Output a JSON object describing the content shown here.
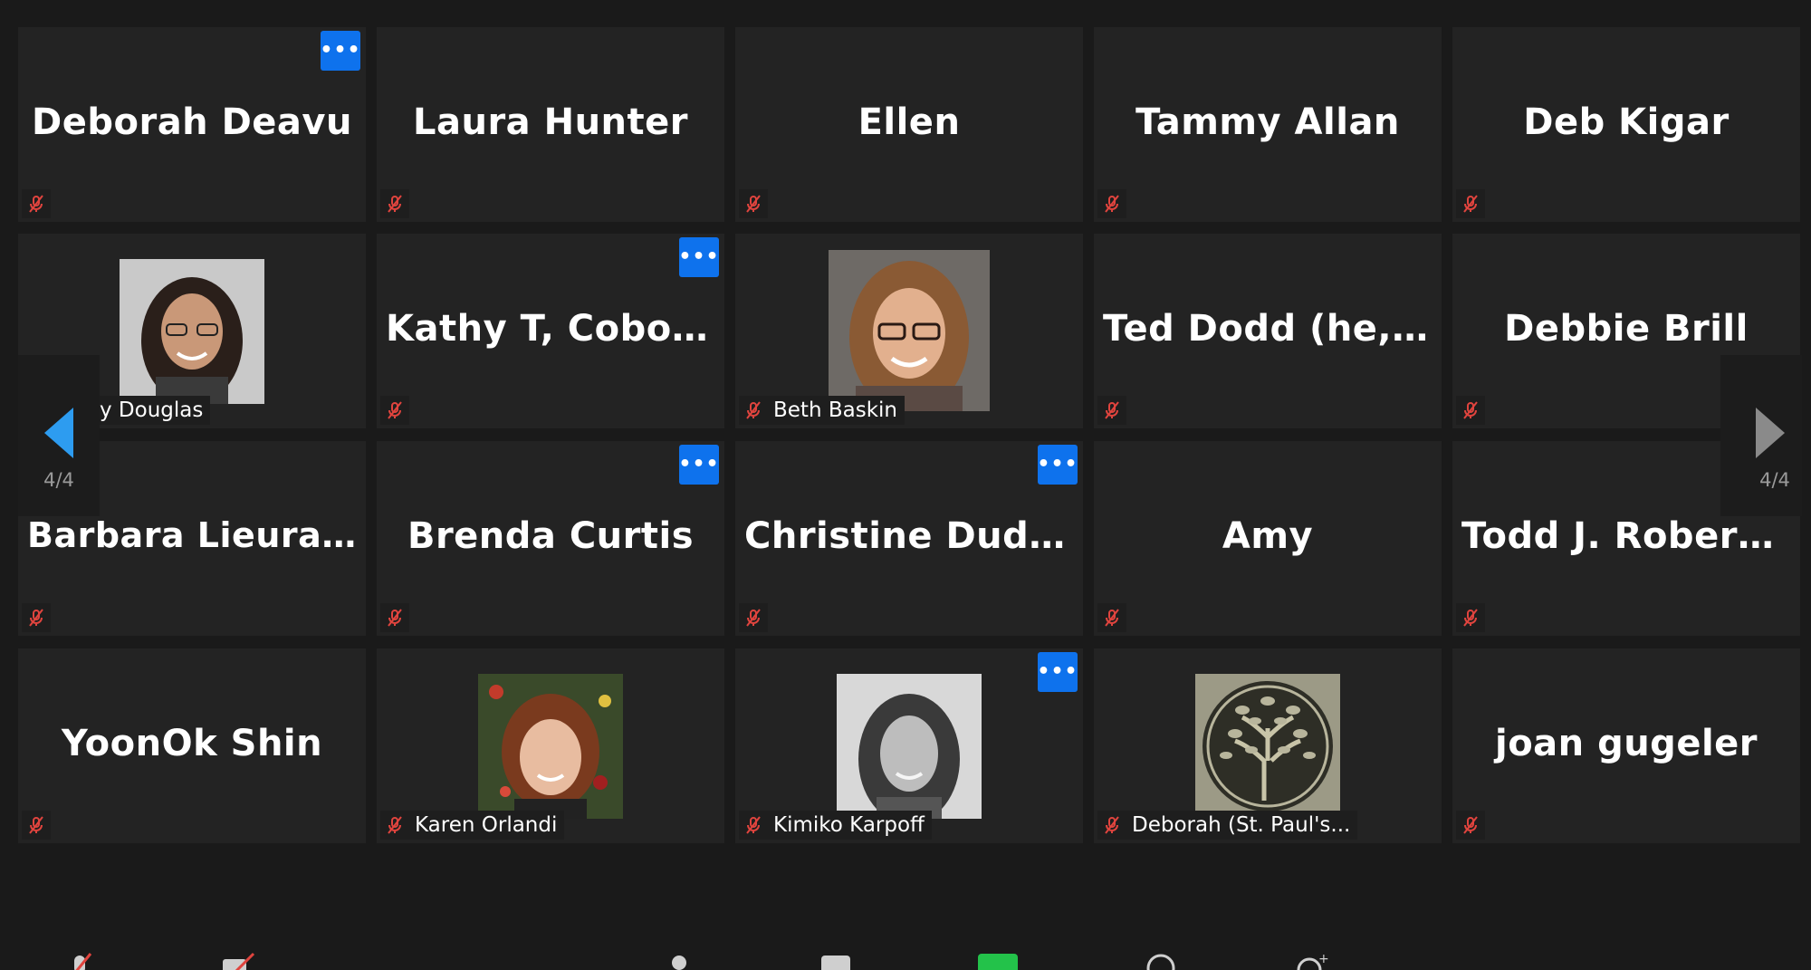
{
  "gallery": {
    "page_indicator": "4/4",
    "participants": [
      {
        "name": "Deborah Deavu",
        "display": "name",
        "more_button": true
      },
      {
        "name": "Laura Hunter",
        "display": "name",
        "more_button": false
      },
      {
        "name": "Ellen",
        "display": "name",
        "more_button": false
      },
      {
        "name": "Tammy Allan",
        "display": "name",
        "more_button": false
      },
      {
        "name": "Deb Kigar",
        "display": "name",
        "more_button": false
      },
      {
        "name": "y Douglas",
        "display": "photo",
        "more_button": false
      },
      {
        "name": "Kathy T, Cobour...",
        "display": "name",
        "more_button": true
      },
      {
        "name": "Beth Baskin",
        "display": "photo",
        "more_button": false
      },
      {
        "name": "Ted Dodd (he, h...",
        "display": "name",
        "more_button": false
      },
      {
        "name": "Debbie Brill",
        "display": "name",
        "more_button": false
      },
      {
        "name": "Barbara Lieurance",
        "display": "name",
        "more_button": false
      },
      {
        "name": "Brenda Curtis",
        "display": "name",
        "more_button": true
      },
      {
        "name": "Christine Dudley",
        "display": "name",
        "more_button": true
      },
      {
        "name": "Amy",
        "display": "name",
        "more_button": false
      },
      {
        "name": "Todd J. Roberts...",
        "display": "name",
        "more_button": false
      },
      {
        "name": "YoonOk Shin",
        "display": "name",
        "more_button": false
      },
      {
        "name": "Karen Orlandi",
        "display": "photo",
        "more_button": false
      },
      {
        "name": "Kimiko Karpoff",
        "display": "photo",
        "more_button": true
      },
      {
        "name": "Deborah (St. Paul's...",
        "display": "photo",
        "more_button": false
      },
      {
        "name": "joan gugeler",
        "display": "name",
        "more_button": false
      }
    ]
  },
  "colors": {
    "background": "#1a1a1a",
    "tile": "#232323",
    "more_button": "#0e72ed",
    "mute_icon": "#e0443e",
    "nav_arrow_active": "#2d9cf0",
    "nav_arrow_inactive": "#8a8a8a"
  },
  "icons": {
    "mute": "mic-muted-icon",
    "more": "more-options-icon",
    "prev": "chevron-left-icon",
    "next": "chevron-right-icon"
  }
}
